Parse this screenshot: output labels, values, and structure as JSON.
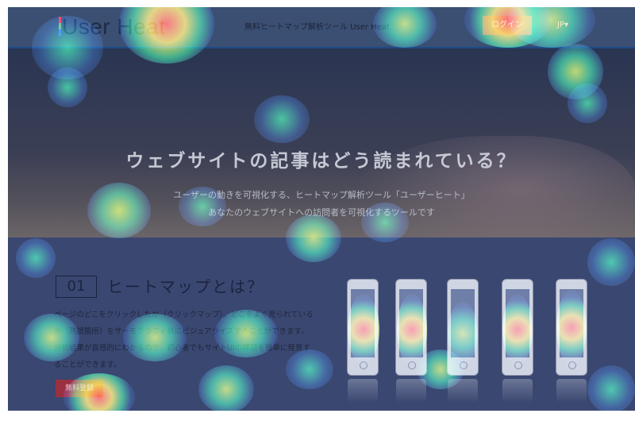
{
  "header": {
    "logo_text": "User Heat",
    "tagline": "無料ヒートマップ解析ツール User Heat",
    "login_label": "ログイン",
    "language_label": "JP▾"
  },
  "hero": {
    "title": "ウェブサイトの記事はどう読まれている？",
    "subtitle_line1": "ユーザーの動きを可視化する、ヒートマップ解析ツール「ユーザーヒート」",
    "subtitle_line2": "あなたのウェブサイトへの訪問者を可視化するツールです"
  },
  "section1": {
    "number": "01",
    "title": "ヒートマップとは？",
    "body": "ページのどこをクリックしたか（クリックマップ）、どこをよく見られているか（熟読箇所）をサーモグラフィ状にビジュアライズすることができます。分析結果が直感的にわかるので、初心者でもサイトUIの課題を簡単に発見することができます。",
    "button_label": "無料登録"
  },
  "colors": {
    "header_bg": "#3b4f73",
    "login_button": "#b8405a",
    "cta_button": "#9b3140",
    "section_bg": "#3a4770"
  },
  "phones": [
    {
      "name": "phone-1"
    },
    {
      "name": "phone-2"
    },
    {
      "name": "phone-3"
    },
    {
      "name": "phone-4"
    },
    {
      "name": "phone-5"
    }
  ]
}
